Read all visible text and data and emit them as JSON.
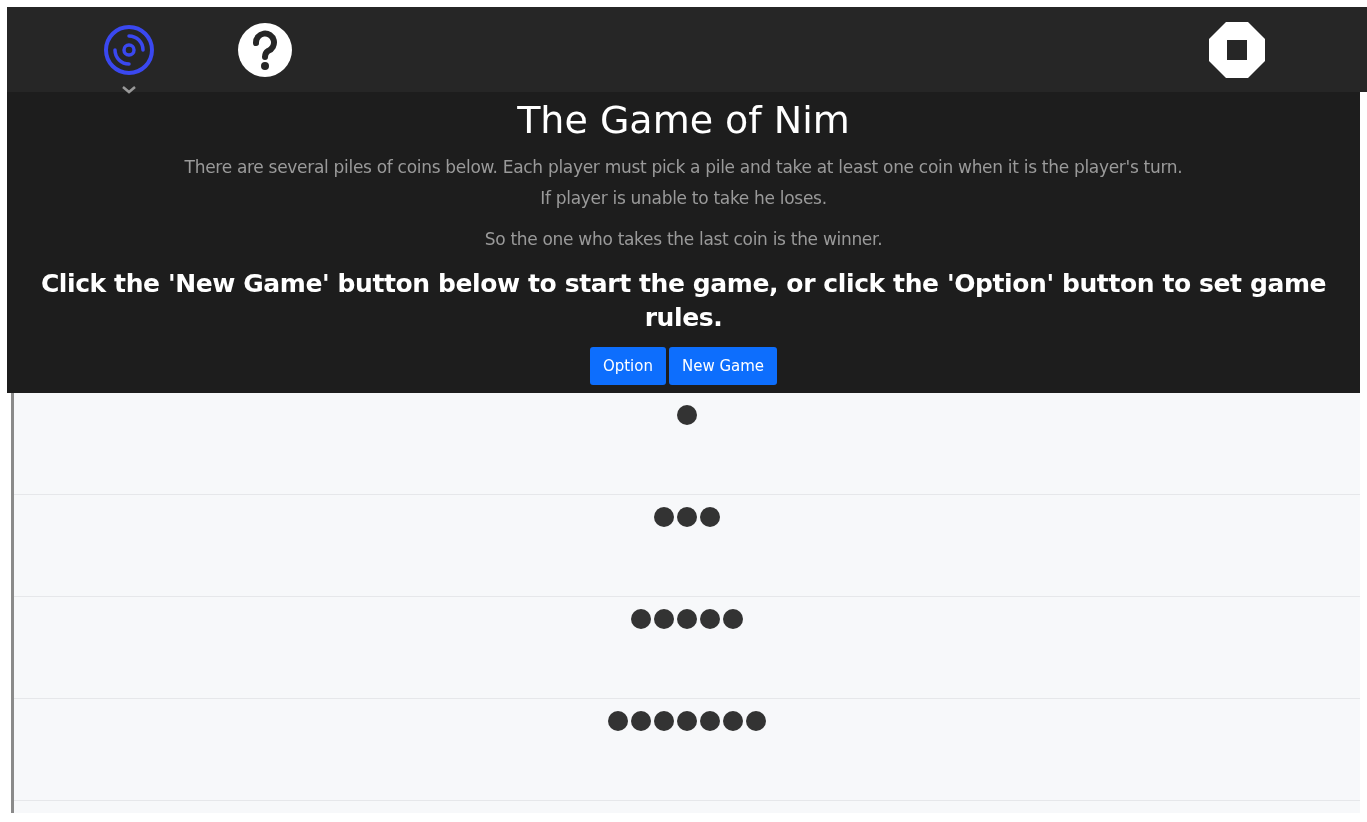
{
  "toolbar": {
    "items": [
      {
        "kind": "disc",
        "selected": true
      },
      {
        "kind": "help",
        "selected": false
      }
    ],
    "end_item": {
      "kind": "stop"
    }
  },
  "title": "The Game of Nim",
  "description": [
    "There are several piles of coins below. Each player must pick a pile and take at least one coin when it is the player's turn.",
    "If player is unable to take he loses."
  ],
  "winner_note": "So the one who takes the last coin is the winner.",
  "instruction": "Click the 'New Game' button below to start the game, or click the 'Option' button to set game rules.",
  "buttons": [
    "Option",
    "New Game"
  ],
  "piles": [
    {
      "coins": [
        {
          "kind": "coin"
        }
      ]
    },
    {
      "coins": [
        {
          "kind": "coin"
        },
        {
          "kind": "coin"
        },
        {
          "kind": "coin"
        }
      ]
    },
    {
      "coins": [
        {
          "kind": "coin"
        },
        {
          "kind": "coin"
        },
        {
          "kind": "coin"
        },
        {
          "kind": "coin"
        },
        {
          "kind": "coin"
        }
      ]
    },
    {
      "coins": [
        {
          "kind": "coin"
        },
        {
          "kind": "coin"
        },
        {
          "kind": "coin"
        },
        {
          "kind": "coin"
        },
        {
          "kind": "coin"
        },
        {
          "kind": "coin"
        },
        {
          "kind": "coin"
        }
      ]
    }
  ]
}
